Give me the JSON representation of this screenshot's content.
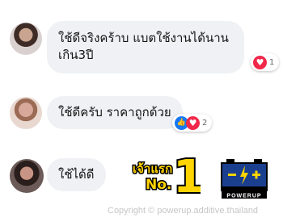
{
  "comments": [
    {
      "lines": [
        "ใช้ดีจริงคร้าบ แบตใช้งานได้นาน",
        "เกิน3ปี"
      ],
      "reactions": [
        "heart-icon"
      ],
      "reaction_count": "1"
    },
    {
      "text": "ใช้ดีครับ ราคาถูกด้วย",
      "reactions": [
        "like-icon",
        "heart-icon"
      ],
      "reaction_count": "2"
    },
    {
      "text": "ใช้ได้ดี"
    }
  ],
  "badge": {
    "text": "เจ้าแรก",
    "sub": "No.",
    "number": "1"
  },
  "battery_logo": {
    "brand": "POWERUP"
  },
  "watermark": "Copyright © powerup.additive.thailand",
  "colors": {
    "bubble": "#eff1f4",
    "heart": "#f0284a",
    "like": "#1877f2",
    "badge_yellow": "#ffd400",
    "battery_blue": "#1b3f8f"
  }
}
